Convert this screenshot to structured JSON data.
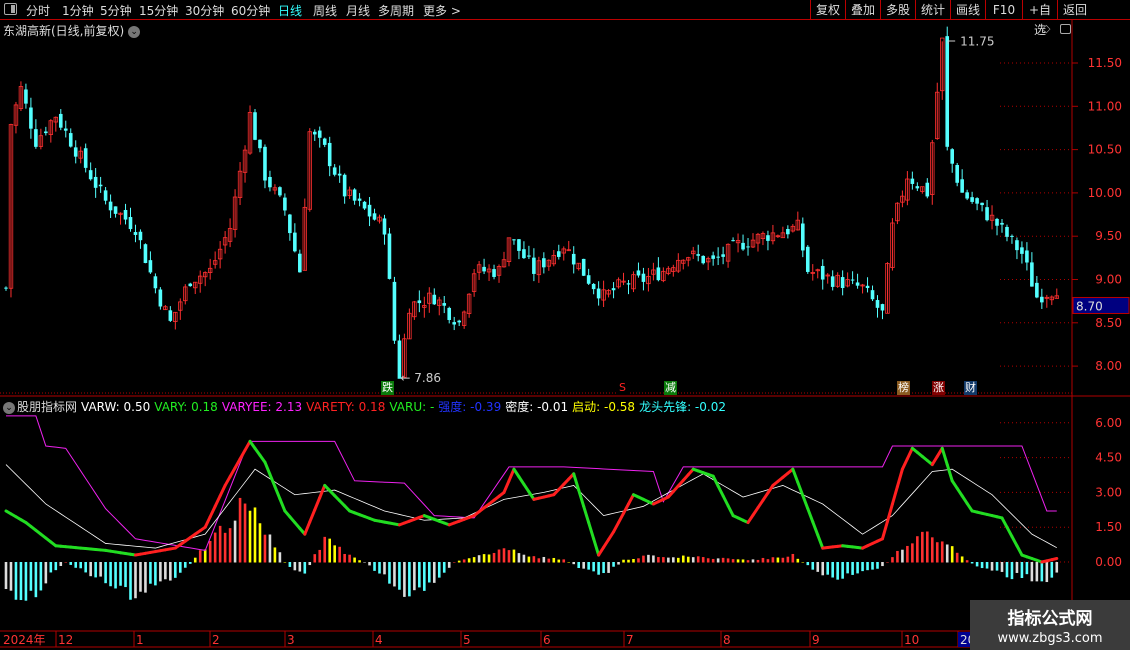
{
  "toolbar": {
    "periods": [
      "分时",
      "1分钟",
      "5分钟",
      "15分钟",
      "30分钟",
      "60分钟",
      "日线",
      "周线",
      "月线",
      "多周期",
      "更多 >"
    ],
    "active": "日线",
    "buttons": [
      "复权",
      "叠加",
      "多股",
      "统计",
      "画线",
      "F10",
      "+自选",
      "返回"
    ]
  },
  "stock_title": "东湖高新(日线,前复权)",
  "price_axis": {
    "ticks": [
      "11.50",
      "11.00",
      "10.50",
      "10.00",
      "9.50",
      "9.00",
      "8.50",
      "8.00"
    ],
    "tick_values": [
      11.5,
      11,
      10.5,
      10,
      9.5,
      9,
      8.5,
      8
    ],
    "current": "8.70"
  },
  "annotations": {
    "high": "11.75",
    "low": "7.86"
  },
  "markers": [
    {
      "text": "跌",
      "color": "#0a7a0a"
    },
    {
      "text": "S",
      "color": "#000"
    },
    {
      "text": "减",
      "color": "#0a7a0a"
    },
    {
      "text": "榜",
      "color": "#8a5a20"
    },
    {
      "text": "涨",
      "color": "#800000"
    },
    {
      "text": "财",
      "color": "#123a6a"
    }
  ],
  "indicator": {
    "name": "股朋指标网",
    "values": [
      {
        "label": "VARW: 0.50",
        "color": "#ffffff"
      },
      {
        "label": "VARY: 0.18",
        "color": "#22ee22"
      },
      {
        "label": "VARYEE: 2.13",
        "color": "#ff22ff"
      },
      {
        "label": "VARETY: 0.18",
        "color": "#ff2222"
      },
      {
        "label": "VARU: -",
        "color": "#22ee22"
      },
      {
        "label": "强度: -0.39",
        "color": "#2233ff"
      },
      {
        "label": "密度: -0.01",
        "color": "#ffffff"
      },
      {
        "label": "启动: -0.58",
        "color": "#ffff00"
      },
      {
        "label": "龙头先锋: -0.02",
        "color": "#33ffff"
      }
    ],
    "axis_ticks": [
      "6.00",
      "4.50",
      "3.00",
      "1.50",
      "0.00"
    ],
    "tick_values": [
      6,
      4.5,
      3,
      1.5,
      0
    ]
  },
  "time_axis": {
    "labels": [
      "2024年",
      "12",
      "1",
      "2",
      "3",
      "4",
      "5",
      "6",
      "7",
      "8",
      "9",
      "10",
      "20"
    ]
  },
  "watermark": {
    "title": "指标公式网",
    "url": "www.zbgs3.com"
  },
  "series": {
    "bars": 212,
    "price_keypoints": [
      [
        1,
        10.8
      ],
      [
        3,
        11.2
      ],
      [
        6,
        10.6
      ],
      [
        10,
        10.9
      ],
      [
        15,
        10.4
      ],
      [
        20,
        9.9
      ],
      [
        26,
        9.6
      ],
      [
        30,
        8.9
      ],
      [
        33,
        8.5
      ],
      [
        37,
        9.0
      ],
      [
        41,
        9.1
      ],
      [
        45,
        9.6
      ],
      [
        49,
        10.9
      ],
      [
        52,
        10.2
      ],
      [
        56,
        9.8
      ],
      [
        59,
        9.1
      ],
      [
        61,
        10.7
      ],
      [
        64,
        10.5
      ],
      [
        68,
        10.0
      ],
      [
        72,
        9.8
      ],
      [
        76,
        9.6
      ],
      [
        78,
        8.3
      ],
      [
        79,
        7.9
      ],
      [
        81,
        8.7
      ],
      [
        86,
        8.8
      ],
      [
        91,
        8.5
      ],
      [
        94,
        9.1
      ],
      [
        99,
        9.1
      ],
      [
        101,
        9.5
      ],
      [
        106,
        9.1
      ],
      [
        112,
        9.4
      ],
      [
        117,
        9.0
      ],
      [
        120,
        8.8
      ],
      [
        124,
        8.95
      ],
      [
        128,
        9.0
      ],
      [
        132,
        9.1
      ],
      [
        136,
        9.3
      ],
      [
        142,
        9.2
      ],
      [
        147,
        9.4
      ],
      [
        152,
        9.5
      ],
      [
        159,
        9.6
      ],
      [
        161,
        9.1
      ],
      [
        166,
        9.0
      ],
      [
        172,
        8.9
      ],
      [
        176,
        8.6
      ],
      [
        178,
        9.6
      ],
      [
        181,
        10.2
      ],
      [
        185,
        10.0
      ],
      [
        188,
        11.75
      ],
      [
        189,
        10.5
      ],
      [
        192,
        10.0
      ],
      [
        198,
        9.7
      ],
      [
        204,
        9.3
      ],
      [
        207,
        8.8
      ],
      [
        211,
        8.9
      ]
    ],
    "osc_keypoints": [
      [
        0,
        2.2
      ],
      [
        4,
        1.7
      ],
      [
        10,
        0.7
      ],
      [
        20,
        0.5
      ],
      [
        26,
        0.3
      ],
      [
        34,
        0.6
      ],
      [
        40,
        1.5
      ],
      [
        44,
        3.3
      ],
      [
        49,
        5.2
      ],
      [
        52,
        4.3
      ],
      [
        56,
        2.2
      ],
      [
        60,
        1.2
      ],
      [
        64,
        3.3
      ],
      [
        69,
        2.2
      ],
      [
        74,
        1.8
      ],
      [
        79,
        1.6
      ],
      [
        84,
        2.0
      ],
      [
        89,
        1.6
      ],
      [
        94,
        2.0
      ],
      [
        100,
        3.0
      ],
      [
        102,
        4.0
      ],
      [
        106,
        2.7
      ],
      [
        110,
        2.9
      ],
      [
        114,
        3.8
      ],
      [
        119,
        0.3
      ],
      [
        122,
        1.3
      ],
      [
        126,
        2.9
      ],
      [
        130,
        2.5
      ],
      [
        133,
        2.8
      ],
      [
        138,
        4.0
      ],
      [
        142,
        3.7
      ],
      [
        146,
        2.0
      ],
      [
        149,
        1.7
      ],
      [
        154,
        3.3
      ],
      [
        158,
        4.0
      ],
      [
        164,
        0.6
      ],
      [
        168,
        0.7
      ],
      [
        172,
        0.6
      ],
      [
        176,
        1.0
      ],
      [
        180,
        4.0
      ],
      [
        182,
        4.9
      ],
      [
        186,
        4.2
      ],
      [
        188,
        4.9
      ],
      [
        190,
        3.5
      ],
      [
        194,
        2.2
      ],
      [
        200,
        1.9
      ],
      [
        204,
        0.3
      ],
      [
        208,
        0.0
      ],
      [
        212,
        0.2
      ]
    ],
    "ma_keypoints": [
      [
        0,
        4.2
      ],
      [
        8,
        2.5
      ],
      [
        20,
        0.8
      ],
      [
        30,
        0.6
      ],
      [
        40,
        1.2
      ],
      [
        50,
        4.0
      ],
      [
        58,
        2.9
      ],
      [
        66,
        3.1
      ],
      [
        76,
        2.2
      ],
      [
        84,
        1.8
      ],
      [
        92,
        1.9
      ],
      [
        100,
        2.7
      ],
      [
        108,
        3.0
      ],
      [
        114,
        3.3
      ],
      [
        120,
        2.0
      ],
      [
        128,
        2.4
      ],
      [
        140,
        3.8
      ],
      [
        148,
        2.8
      ],
      [
        156,
        3.3
      ],
      [
        164,
        2.5
      ],
      [
        172,
        1.2
      ],
      [
        178,
        2.0
      ],
      [
        186,
        3.9
      ],
      [
        190,
        4.0
      ],
      [
        198,
        2.9
      ],
      [
        206,
        1.2
      ],
      [
        212,
        0.5
      ]
    ],
    "step_keypoints": [
      [
        0,
        6.3
      ],
      [
        6,
        6.3
      ],
      [
        8,
        5.0
      ],
      [
        12,
        4.9
      ],
      [
        20,
        2.3
      ],
      [
        26,
        1.0
      ],
      [
        40,
        0.5
      ],
      [
        48,
        4.8
      ],
      [
        49,
        5.2
      ],
      [
        66,
        5.2
      ],
      [
        70,
        3.5
      ],
      [
        80,
        3.4
      ],
      [
        86,
        2.0
      ],
      [
        94,
        1.9
      ],
      [
        101,
        4.1
      ],
      [
        112,
        4.1
      ],
      [
        130,
        3.9
      ],
      [
        132,
        2.6
      ],
      [
        136,
        4.1
      ],
      [
        176,
        4.1
      ],
      [
        178,
        5.0
      ],
      [
        204,
        5.0
      ],
      [
        209,
        2.2
      ],
      [
        212,
        2.2
      ]
    ],
    "hist_keypoints": [
      [
        0,
        -1.0
      ],
      [
        4,
        -1.7
      ],
      [
        8,
        -0.8
      ],
      [
        12,
        0
      ],
      [
        18,
        -0.6
      ],
      [
        24,
        -1.5
      ],
      [
        30,
        -1.2
      ],
      [
        36,
        -0.3
      ],
      [
        38,
        0.2
      ],
      [
        42,
        1.2
      ],
      [
        48,
        2.6
      ],
      [
        52,
        1.5
      ],
      [
        56,
        0
      ],
      [
        58,
        -0.4
      ],
      [
        60,
        -0.6
      ],
      [
        62,
        0.3
      ],
      [
        64,
        1.0
      ],
      [
        68,
        0.4
      ],
      [
        72,
        0
      ],
      [
        78,
        -1.0
      ],
      [
        80,
        -1.5
      ],
      [
        86,
        -0.8
      ],
      [
        90,
        0
      ],
      [
        94,
        0.2
      ],
      [
        100,
        0.6
      ],
      [
        104,
        0.3
      ],
      [
        112,
        0.1
      ],
      [
        116,
        -0.3
      ],
      [
        120,
        -0.6
      ],
      [
        124,
        0.1
      ],
      [
        130,
        0.3
      ],
      [
        140,
        0.2
      ],
      [
        150,
        0.1
      ],
      [
        158,
        0.3
      ],
      [
        162,
        -0.3
      ],
      [
        166,
        -0.7
      ],
      [
        172,
        -0.5
      ],
      [
        176,
        -0.2
      ],
      [
        180,
        0.6
      ],
      [
        184,
        1.5
      ],
      [
        188,
        1.0
      ],
      [
        192,
        0.2
      ],
      [
        196,
        -0.3
      ],
      [
        202,
        -0.6
      ],
      [
        208,
        -0.8
      ],
      [
        212,
        -0.5
      ]
    ]
  },
  "colors": {
    "up": "#ff3030",
    "down": "#54ffff",
    "axis": "#b00000",
    "osc_up": "#ff2020",
    "osc_down": "#22dd22",
    "step": "#ee22ee",
    "ma": "#ffffff"
  }
}
